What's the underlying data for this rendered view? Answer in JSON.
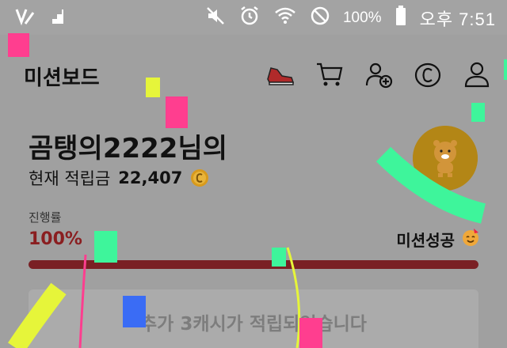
{
  "status_bar": {
    "battery_percent": "100%",
    "clock": "오후 7:51",
    "icons": [
      "app-logo-icon",
      "signal-stairs-icon",
      "mute-icon",
      "alarm-icon",
      "wifi-icon",
      "blocked-icon",
      "battery-icon"
    ]
  },
  "header": {
    "title": "미션보드",
    "icons": [
      "sneaker-icon",
      "cart-icon",
      "add-friend-icon",
      "cash-coin-icon",
      "profile-icon"
    ]
  },
  "profile": {
    "username": "곰탱의2222님의",
    "balance_label": "현재 적립금",
    "balance_amount": "22,407"
  },
  "progress": {
    "label": "진행률",
    "percent_text": "100%",
    "value": 1.0,
    "status": "미션성공"
  },
  "notice": {
    "text": "추가 3캐시가 적립되었습니다"
  },
  "colors": {
    "accent": "#7a2024",
    "coin": "#d89a1c",
    "confetti": [
      "#ff3e8f",
      "#3ef59b",
      "#e6f53a",
      "#3a6cf5"
    ]
  }
}
